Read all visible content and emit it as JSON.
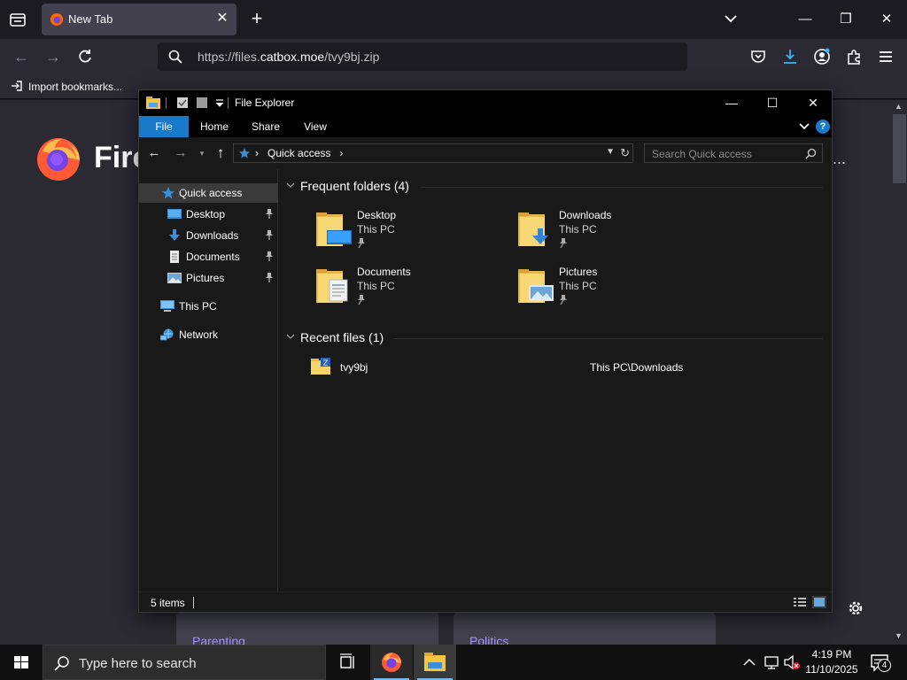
{
  "firefox": {
    "tab": {
      "title": "New Tab"
    },
    "url": {
      "prefix": "https://files.",
      "host": "catbox.moe",
      "path": "/tvy9bj.zip"
    },
    "bookmarks": {
      "import_label": "Import bookmarks..."
    },
    "content": {
      "wordmark": "Fire",
      "more_dots": "...",
      "cards": [
        {
          "label": "Parenting"
        },
        {
          "label": "Politics"
        }
      ]
    }
  },
  "explorer": {
    "title": "File Explorer",
    "ribbon_tabs": [
      "File",
      "Home",
      "Share",
      "View"
    ],
    "help": "?",
    "address": {
      "location": "Quick access"
    },
    "search_placeholder": "Search Quick access",
    "nav_pane": {
      "quick_access": "Quick access",
      "pinned": [
        {
          "label": "Desktop"
        },
        {
          "label": "Downloads"
        },
        {
          "label": "Documents"
        },
        {
          "label": "Pictures"
        }
      ],
      "this_pc": "This PC",
      "network": "Network"
    },
    "frequent": {
      "header": "Frequent folders (4)",
      "folders": [
        {
          "name": "Desktop",
          "location": "This PC"
        },
        {
          "name": "Downloads",
          "location": "This PC"
        },
        {
          "name": "Documents",
          "location": "This PC"
        },
        {
          "name": "Pictures",
          "location": "This PC"
        }
      ]
    },
    "recent": {
      "header": "Recent files (1)",
      "files": [
        {
          "name": "tvy9bj",
          "path": "This PC\\Downloads"
        }
      ]
    },
    "status": {
      "items": "5 items"
    }
  },
  "taskbar": {
    "search_placeholder": "Type here to search",
    "clock": {
      "time": "4:19 PM",
      "date": "11/10/2025"
    },
    "notification_count": "4"
  },
  "colors": {
    "explorer_accent": "#1979ca",
    "firefox_link": "#a493ff",
    "taskbar_active": "#76b9ed"
  }
}
